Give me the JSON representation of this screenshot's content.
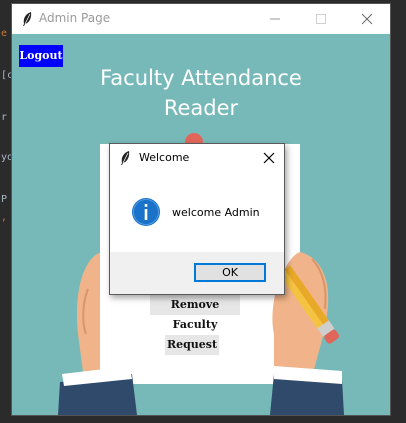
{
  "window": {
    "title": "Admin Page",
    "controls": [
      "minimize-icon",
      "maximize-icon",
      "close-icon"
    ]
  },
  "app": {
    "logout_label": "Logout",
    "title_line1": "Faculty Attendance",
    "title_line2": "Reader",
    "buttons": {
      "remove_faculty": "Remove Faculty",
      "request": "Request"
    }
  },
  "dialog": {
    "title": "Welcome",
    "message": "welcome Admin",
    "icon": "info-icon",
    "ok_label": "OK"
  },
  "background_editor": {
    "visible_glyphs": [
      "e",
      "[c",
      "r",
      "yo",
      "P",
      ","
    ]
  },
  "colors": {
    "client_bg": "#77b9b8",
    "logout_bg": "#0000ff",
    "info_icon": "#1a73c9",
    "focus_border": "#0078d7"
  }
}
